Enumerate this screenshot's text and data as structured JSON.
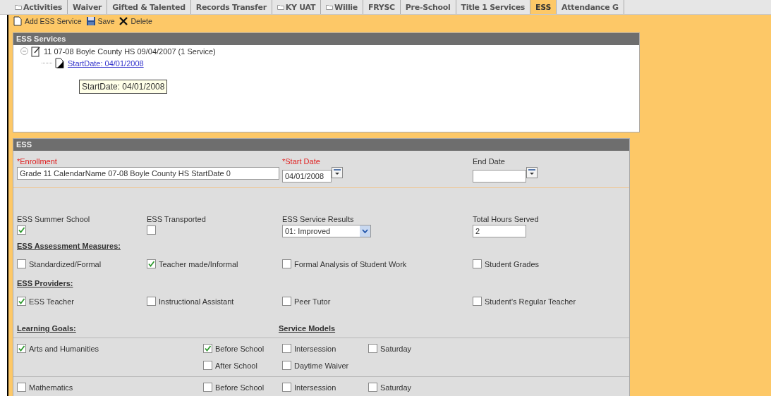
{
  "tabs": [
    {
      "label": "Activities",
      "has_icon": true,
      "selected": false
    },
    {
      "label": "Waiver",
      "has_icon": false,
      "selected": false
    },
    {
      "label": "Gifted & Talented",
      "has_icon": false,
      "selected": false
    },
    {
      "label": "Records Transfer",
      "has_icon": false,
      "selected": false
    },
    {
      "label": "KY UAT",
      "has_icon": true,
      "selected": false
    },
    {
      "label": "Willie",
      "has_icon": true,
      "selected": false
    },
    {
      "label": "FRYSC",
      "has_icon": false,
      "selected": false
    },
    {
      "label": "Pre-School",
      "has_icon": false,
      "selected": false
    },
    {
      "label": "Title 1 Services",
      "has_icon": false,
      "selected": false
    },
    {
      "label": "ESS",
      "has_icon": false,
      "selected": true
    },
    {
      "label": "Attendance G",
      "has_icon": false,
      "selected": false
    }
  ],
  "toolbar": [
    {
      "kind": "add",
      "label": "Add ESS Service"
    },
    {
      "kind": "save",
      "label": "Save"
    },
    {
      "kind": "delete",
      "label": "Delete"
    }
  ],
  "services": {
    "title": "ESS Services",
    "tree": [
      {
        "label": "11 07-08 Boyle County HS 09/04/2007 (1 Service)",
        "expanded": true,
        "children": [
          {
            "label": "StartDate: 04/01/2008"
          }
        ]
      }
    ],
    "tooltip": "StartDate: 04/01/2008"
  },
  "ess": {
    "title": "ESS",
    "enrollment": {
      "label": "*Enrollment",
      "required": true,
      "value": "Grade 11 CalendarName 07-08 Boyle County HS StartDate 0"
    },
    "start_date": {
      "label": "*Start Date",
      "required": true,
      "value": "04/01/2008"
    },
    "end_date": {
      "label": "End Date",
      "required": false
    },
    "summer_school": {
      "label": "ESS Summer School",
      "checked": true
    },
    "transported": {
      "label": "ESS Transported",
      "checked": false
    },
    "service_results": {
      "label": "ESS Service Results",
      "value": "01: Improved"
    },
    "total_hours": {
      "label": "Total Hours Served",
      "value": "2"
    },
    "sections": [
      {
        "title": "ESS Assessment Measures:",
        "items": [
          {
            "label": "Standardized/Formal",
            "checked": false
          },
          {
            "label": "Teacher made/Informal",
            "checked": true
          },
          {
            "label": "Formal Analysis of Student Work",
            "checked": false
          },
          {
            "label": "Student Grades",
            "checked": false
          }
        ]
      },
      {
        "title": "ESS Providers:",
        "items": [
          {
            "label": "ESS Teacher",
            "checked": true
          },
          {
            "label": "Instructional Assistant",
            "checked": false
          },
          {
            "label": "Peer Tutor",
            "checked": false
          },
          {
            "label": "Student's Regular Teacher",
            "checked": false
          }
        ]
      }
    ],
    "goals_title": "Learning Goals:",
    "models_title": "Service Models",
    "goals": [
      {
        "label": "Arts and Humanities",
        "checked": true,
        "models": [
          {
            "label": "Before School",
            "checked": true
          },
          {
            "label": "Intersession",
            "checked": false
          },
          {
            "label": "Saturday",
            "checked": false
          },
          {
            "label": "After School",
            "checked": false
          },
          {
            "label": "Daytime Waiver",
            "checked": false
          }
        ]
      },
      {
        "label": "Mathematics",
        "checked": false,
        "models": [
          {
            "label": "Before School",
            "checked": false
          },
          {
            "label": "Intersession",
            "checked": false
          },
          {
            "label": "Saturday",
            "checked": false
          }
        ]
      }
    ]
  }
}
